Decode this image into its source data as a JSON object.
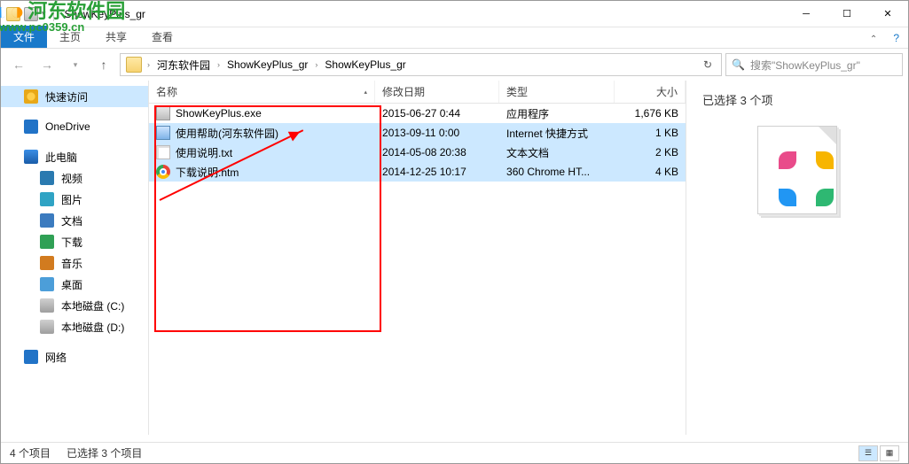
{
  "window": {
    "title": "ShowKeyPlus_gr"
  },
  "ribbon": {
    "file": "文件",
    "home": "主页",
    "share": "共享",
    "view": "查看"
  },
  "nav": {
    "crumbs": [
      "河东软件园",
      "ShowKeyPlus_gr",
      "ShowKeyPlus_gr"
    ],
    "search_placeholder": "搜索\"ShowKeyPlus_gr\""
  },
  "sidebar": {
    "items": [
      {
        "label": "快速访问"
      },
      {
        "label": "OneDrive"
      },
      {
        "label": "此电脑"
      },
      {
        "label": "视频"
      },
      {
        "label": "图片"
      },
      {
        "label": "文档"
      },
      {
        "label": "下载"
      },
      {
        "label": "音乐"
      },
      {
        "label": "桌面"
      },
      {
        "label": "本地磁盘 (C:)"
      },
      {
        "label": "本地磁盘 (D:)"
      },
      {
        "label": "网络"
      }
    ]
  },
  "columns": {
    "name": "名称",
    "date": "修改日期",
    "type": "类型",
    "size": "大小"
  },
  "files": [
    {
      "name": "ShowKeyPlus.exe",
      "date": "2015-06-27 0:44",
      "type": "应用程序",
      "size": "1,676 KB"
    },
    {
      "name": "使用帮助(河东软件园)",
      "date": "2013-09-11 0:00",
      "type": "Internet 快捷方式",
      "size": "1 KB"
    },
    {
      "name": "使用说明.txt",
      "date": "2014-05-08 20:38",
      "type": "文本文档",
      "size": "2 KB"
    },
    {
      "name": "下载说明.htm",
      "date": "2014-12-25 10:17",
      "type": "360 Chrome HT...",
      "size": "4 KB"
    }
  ],
  "preview": {
    "text": "已选择 3 个项"
  },
  "status": {
    "count": "4 个项目",
    "selected": "已选择 3 个项目"
  },
  "watermark": {
    "text": "河东软件园",
    "url": "www.pc0359.cn"
  }
}
